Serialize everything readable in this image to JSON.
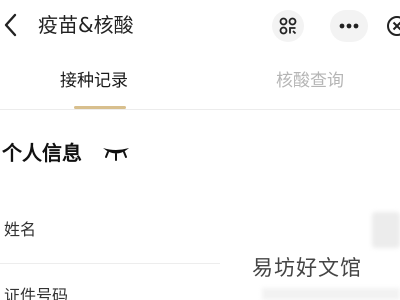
{
  "header": {
    "title": "疫苗&核酸",
    "icons": {
      "back": "chevron-left-icon",
      "scan": "scan-icon",
      "more": "more-dots-icon",
      "close": "close-circle-icon"
    }
  },
  "tabs": [
    {
      "label": "接种记录",
      "active": true
    },
    {
      "label": "核酸查询",
      "active": false
    }
  ],
  "section": {
    "title": "个人信息",
    "toggle_icon": "eye-closed-icon"
  },
  "fields": [
    {
      "label": "姓名"
    },
    {
      "label": "证件号码"
    }
  ],
  "watermark": "易坊好文馆",
  "colors": {
    "accent": "#d8bf8d",
    "inactive_tab": "#b5b5b5",
    "icon_bg": "#f3f3f3"
  }
}
